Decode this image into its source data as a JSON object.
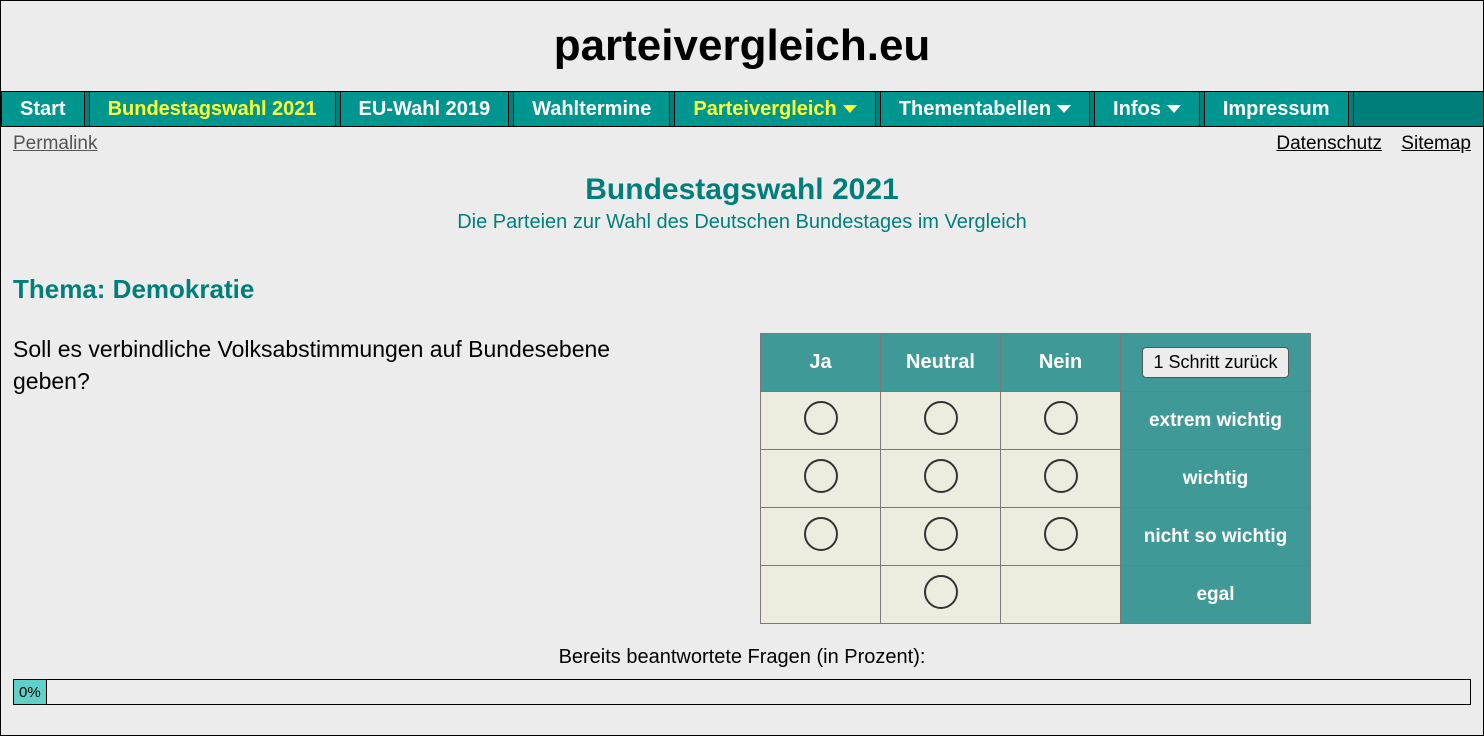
{
  "site_title": "parteivergleich.eu",
  "nav": [
    {
      "label": "Start",
      "active": false,
      "dropdown": false
    },
    {
      "label": "Bundestagswahl 2021",
      "active": true,
      "dropdown": false
    },
    {
      "label": "EU-Wahl 2019",
      "active": false,
      "dropdown": false
    },
    {
      "label": "Wahltermine",
      "active": false,
      "dropdown": false
    },
    {
      "label": "Parteivergleich",
      "active": true,
      "dropdown": true
    },
    {
      "label": "Thementabellen",
      "active": false,
      "dropdown": true
    },
    {
      "label": "Infos",
      "active": false,
      "dropdown": true
    },
    {
      "label": "Impressum",
      "active": false,
      "dropdown": false
    }
  ],
  "sublinks": {
    "permalink": "Permalink",
    "datenschutz": "Datenschutz",
    "sitemap": "Sitemap"
  },
  "page": {
    "title": "Bundestagswahl 2021",
    "subtitle": "Die Parteien zur Wahl des Deutschen Bundestages im Vergleich"
  },
  "topic_label": "Thema: Demokratie",
  "question": "Soll es verbindliche Volksabstimmungen auf Bundesebene geben?",
  "vote": {
    "columns": [
      "Ja",
      "Neutral",
      "Nein"
    ],
    "back_label": "1 Schritt zurück",
    "rows": [
      {
        "label": "extrem wichtig",
        "radios": [
          true,
          true,
          true
        ]
      },
      {
        "label": "wichtig",
        "radios": [
          true,
          true,
          true
        ]
      },
      {
        "label": "nicht so wichtig",
        "radios": [
          true,
          true,
          true
        ]
      },
      {
        "label": "egal",
        "radios": [
          false,
          true,
          false
        ]
      }
    ]
  },
  "progress": {
    "caption": "Bereits beantwortete Fragen (in Prozent):",
    "percent_text": "0%",
    "percent_value": 0
  }
}
